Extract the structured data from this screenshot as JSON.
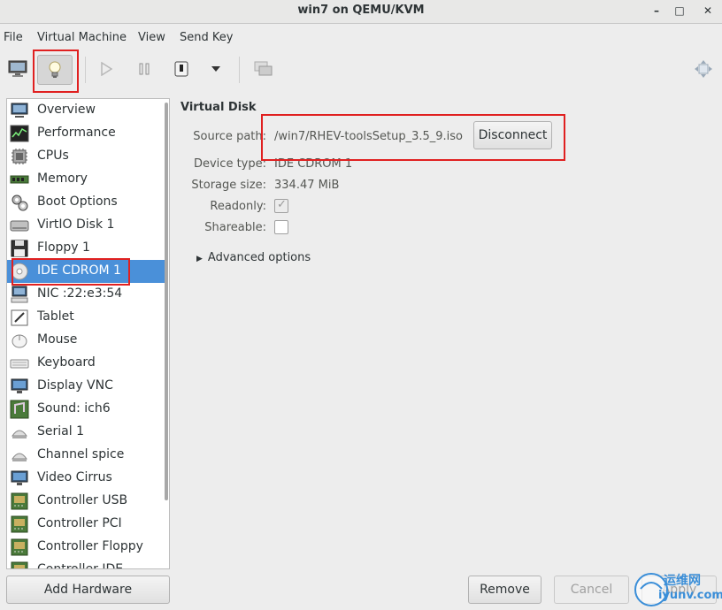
{
  "window": {
    "title": "win7 on QEMU/KVM",
    "minimize": "–",
    "maximize": "□",
    "close": "✕"
  },
  "menu": [
    "File",
    "Virtual Machine",
    "View",
    "Send Key"
  ],
  "sidebar": {
    "items": [
      {
        "label": "Overview",
        "icon": "monitor-icon"
      },
      {
        "label": "Performance",
        "icon": "chart-icon"
      },
      {
        "label": "CPUs",
        "icon": "cpu-icon"
      },
      {
        "label": "Memory",
        "icon": "memory-icon"
      },
      {
        "label": "Boot Options",
        "icon": "gear-icon"
      },
      {
        "label": "VirtIO Disk 1",
        "icon": "disk-icon"
      },
      {
        "label": "Floppy 1",
        "icon": "floppy-icon"
      },
      {
        "label": "IDE CDROM 1",
        "icon": "cdrom-icon",
        "selected": true
      },
      {
        "label": "NIC :22:e3:54",
        "icon": "network-icon"
      },
      {
        "label": "Tablet",
        "icon": "tablet-icon"
      },
      {
        "label": "Mouse",
        "icon": "mouse-icon"
      },
      {
        "label": "Keyboard",
        "icon": "keyboard-icon"
      },
      {
        "label": "Display VNC",
        "icon": "display-icon"
      },
      {
        "label": "Sound: ich6",
        "icon": "sound-icon"
      },
      {
        "label": "Serial 1",
        "icon": "serial-icon"
      },
      {
        "label": "Channel spice",
        "icon": "channel-icon"
      },
      {
        "label": "Video Cirrus",
        "icon": "video-icon"
      },
      {
        "label": "Controller USB",
        "icon": "controller-icon"
      },
      {
        "label": "Controller PCI",
        "icon": "controller-icon"
      },
      {
        "label": "Controller Floppy",
        "icon": "controller-icon"
      },
      {
        "label": "Controller IDE",
        "icon": "controller-icon"
      }
    ]
  },
  "detail": {
    "section_title": "Virtual Disk",
    "source_path_label": "Source path:",
    "source_path_value": "/win7/RHEV-toolsSetup_3.5_9.iso",
    "disconnect_label": "Disconnect",
    "device_type_label": "Device type:",
    "device_type_value": "IDE CDROM 1",
    "storage_size_label": "Storage size:",
    "storage_size_value": "334.47 MiB",
    "readonly_label": "Readonly:",
    "readonly_checked": true,
    "shareable_label": "Shareable:",
    "shareable_checked": false,
    "advanced_label": "Advanced options"
  },
  "buttons": {
    "add_hardware": "Add Hardware",
    "remove": "Remove",
    "cancel": "Cancel",
    "apply": "Apply"
  },
  "watermark": {
    "text_cn": "运维网",
    "text_en": "iyunv.com"
  },
  "colors": {
    "selection": "#4a90d9",
    "highlight_box": "#e02020"
  }
}
